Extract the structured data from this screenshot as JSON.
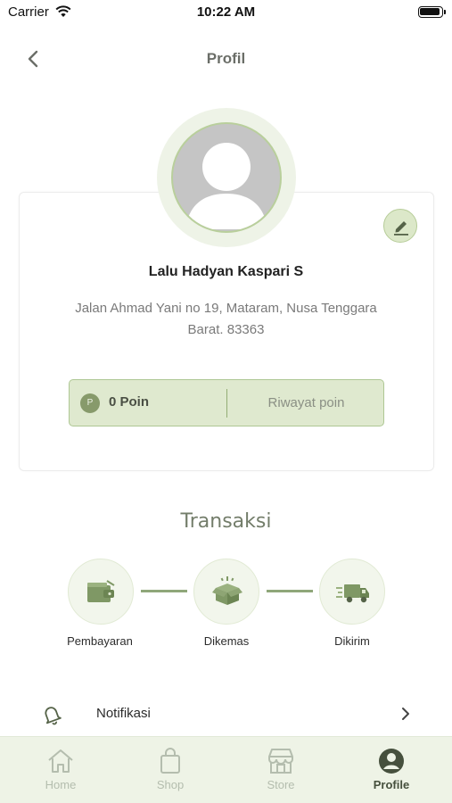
{
  "status_bar": {
    "carrier": "Carrier",
    "time": "10:22 AM"
  },
  "header": {
    "title": "Profil",
    "back_icon": "chevron-left-icon"
  },
  "profile": {
    "name": "Lalu Hadyan Kaspari S",
    "address": "Jalan Ahmad Yani no 19, Mataram, Nusa Tenggara Barat. 83363",
    "edit_icon": "pencil-icon",
    "points": {
      "badge": "P",
      "value": "0 Poin",
      "history_label": "Riwayat poin"
    }
  },
  "transactions": {
    "title": "Transaksi",
    "steps": [
      {
        "label": "Pembayaran",
        "icon": "wallet-icon"
      },
      {
        "label": "Dikemas",
        "icon": "box-icon"
      },
      {
        "label": "Dikirim",
        "icon": "truck-icon"
      }
    ]
  },
  "menu": [
    {
      "label": "Notifikasi",
      "icon": "bell-icon"
    }
  ],
  "tab_bar": {
    "tabs": [
      {
        "label": "Home",
        "icon": "home-icon",
        "active": false
      },
      {
        "label": "Shop",
        "icon": "shopping-bag-icon",
        "active": false
      },
      {
        "label": "Store",
        "icon": "store-icon",
        "active": false
      },
      {
        "label": "Profile",
        "icon": "user-circle-icon",
        "active": true
      }
    ]
  },
  "colors": {
    "accent": "#dfe9cf",
    "accent_border": "#aec794",
    "accent_dark": "#879a6b",
    "tab_bar_bg": "#eef3e6"
  }
}
